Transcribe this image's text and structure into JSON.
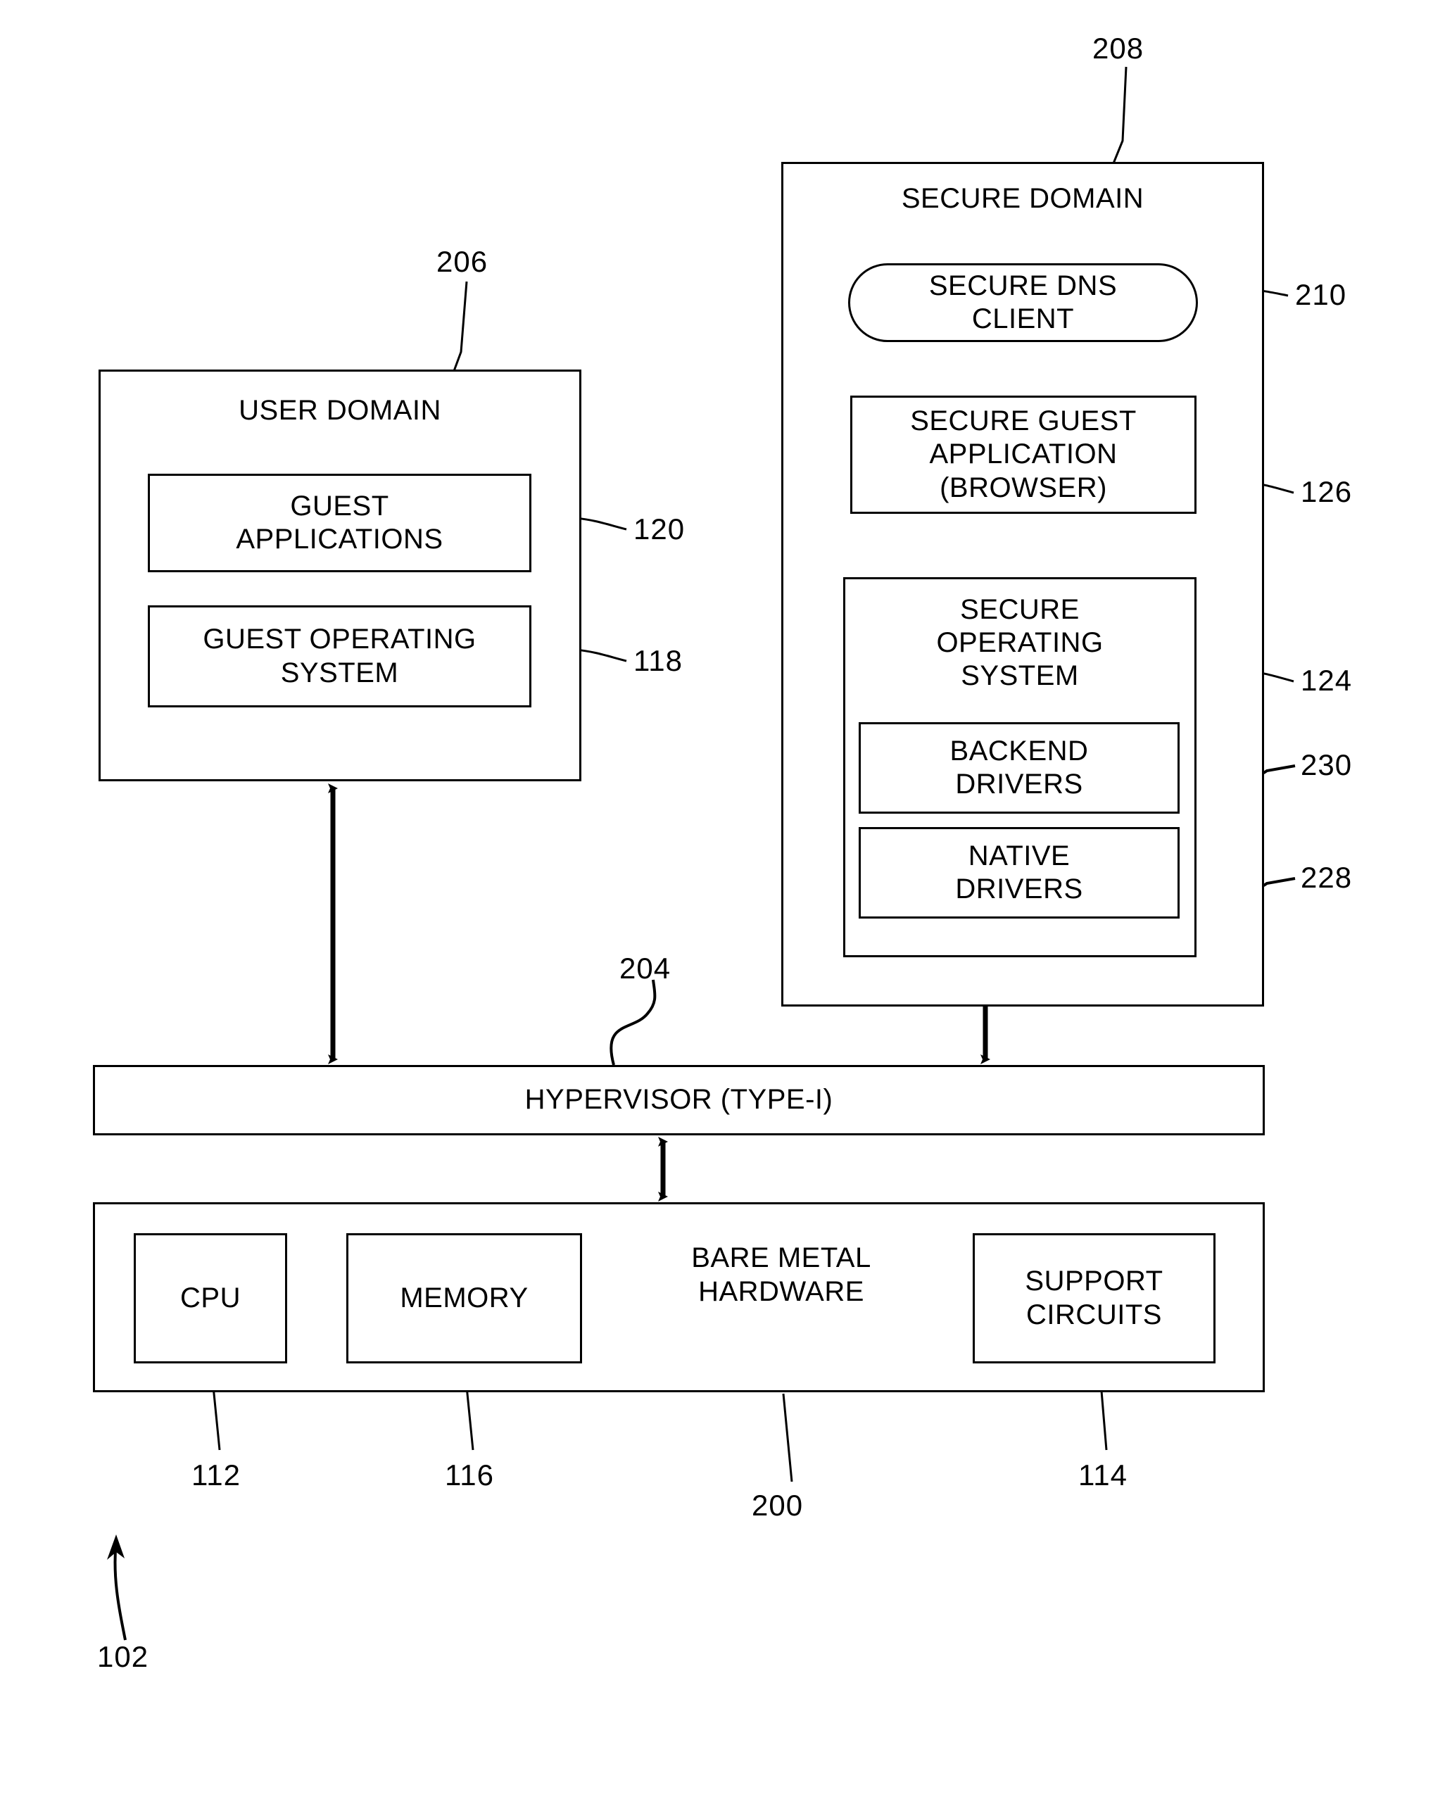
{
  "figure": {
    "type": "patent-block-diagram",
    "background": "#ffffff",
    "line_color": "#000000"
  },
  "user_domain": {
    "title": "USER DOMAIN",
    "ref": "206",
    "blocks": [
      {
        "label": "GUEST\nAPPLICATIONS",
        "ref": "120"
      },
      {
        "label": "GUEST OPERATING\nSYSTEM",
        "ref": "118"
      }
    ]
  },
  "secure_domain": {
    "title": "SECURE DOMAIN",
    "ref": "208",
    "dns_client": {
      "label": "SECURE DNS\nCLIENT",
      "ref": "210"
    },
    "guest_app": {
      "label": "SECURE GUEST\nAPPLICATION\n(BROWSER)",
      "ref": "126"
    },
    "secure_os": {
      "label": "SECURE\nOPERATING\nSYSTEM",
      "ref": "124",
      "drivers": [
        {
          "label": "BACKEND\nDRIVERS",
          "ref": "230"
        },
        {
          "label": "NATIVE\nDRIVERS",
          "ref": "228"
        }
      ]
    }
  },
  "hypervisor": {
    "label": "HYPERVISOR (TYPE-I)",
    "ref": "204"
  },
  "bare_metal": {
    "label": "BARE METAL\nHARDWARE",
    "ref": "200",
    "components": [
      {
        "label": "CPU",
        "ref": "112"
      },
      {
        "label": "MEMORY",
        "ref": "116"
      },
      {
        "label": "SUPPORT\nCIRCUITS",
        "ref": "114"
      }
    ]
  },
  "system": {
    "ref": "102"
  },
  "refs": {
    "r206": "206",
    "r208": "208",
    "r210": "210",
    "r126": "126",
    "r124": "124",
    "r230": "230",
    "r228": "228",
    "r120": "120",
    "r118": "118",
    "r204": "204",
    "r112": "112",
    "r116": "116",
    "r200": "200",
    "r114": "114",
    "r102": "102"
  }
}
